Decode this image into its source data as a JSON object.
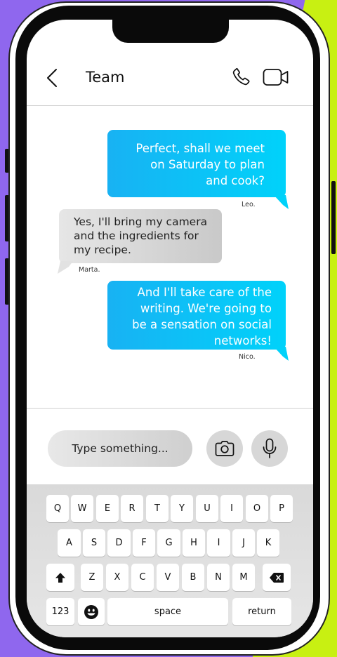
{
  "header": {
    "title": "Team"
  },
  "messages": [
    {
      "direction": "out",
      "text": "Perfect, shall we meet\non Saturday to plan\nand cook?",
      "sender": "Leo."
    },
    {
      "direction": "in",
      "text": "Yes, I'll bring my camera\nand the ingredients for\nmy recipe.",
      "sender": "Marta."
    },
    {
      "direction": "out",
      "text": "And I'll take care of the\nwriting. We're going to\nbe a sensation on social\nnetworks!",
      "sender": "Nico."
    }
  ],
  "composer": {
    "placeholder": "Type something..."
  },
  "keyboard": {
    "row1": [
      "Q",
      "W",
      "E",
      "R",
      "T",
      "Y",
      "U",
      "I",
      "O",
      "P"
    ],
    "row2": [
      "A",
      "S",
      "D",
      "F",
      "G",
      "H",
      "I",
      "J",
      "K"
    ],
    "row3": [
      "Z",
      "X",
      "C",
      "V",
      "B",
      "N",
      "M"
    ],
    "numbers_label": "123",
    "space_label": "space",
    "return_label": "return",
    "shift_icon": "shift-icon",
    "delete_icon": "backspace-icon",
    "emoji_icon": "emoji-icon"
  },
  "colors": {
    "outgoing_bubble": "#00c8f8",
    "incoming_bubble": "#d4d4d4",
    "background_purple": "#8f67ee",
    "background_yellow": "#c8f012"
  }
}
